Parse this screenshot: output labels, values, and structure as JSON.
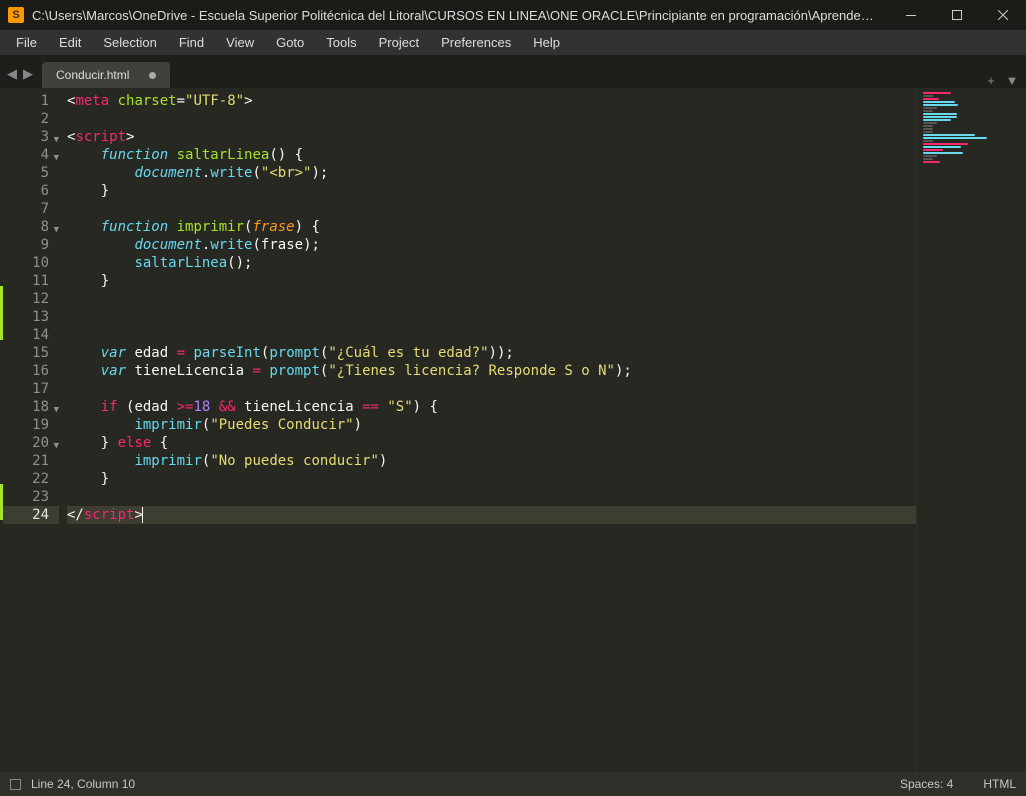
{
  "window": {
    "title": "C:\\Users\\Marcos\\OneDrive - Escuela Superior Politécnica del Litoral\\CURSOS EN LINEA\\ONE ORACLE\\Principiante en programación\\Aprender Logica de progra...",
    "logo_letter": "S"
  },
  "menu": {
    "items": [
      "File",
      "Edit",
      "Selection",
      "Find",
      "View",
      "Goto",
      "Tools",
      "Project",
      "Preferences",
      "Help"
    ]
  },
  "tabs": {
    "active": "Conducir.html",
    "active_dirty": true
  },
  "status": {
    "cursor": "Line 24, Column 10",
    "spacing": "Spaces: 4",
    "syntax": "HTML"
  },
  "code": {
    "lines": [
      {
        "n": 1,
        "fold": false,
        "tokens": [
          [
            "punc",
            "<"
          ],
          [
            "tag",
            "meta"
          ],
          [
            "punc",
            " "
          ],
          [
            "attr",
            "charset"
          ],
          [
            "punc",
            "="
          ],
          [
            "str",
            "\"UTF-8\""
          ],
          [
            "punc",
            ">"
          ]
        ]
      },
      {
        "n": 2,
        "fold": false,
        "tokens": []
      },
      {
        "n": 3,
        "fold": true,
        "tokens": [
          [
            "punc",
            "<"
          ],
          [
            "tag",
            "script"
          ],
          [
            "punc",
            ">"
          ]
        ]
      },
      {
        "n": 4,
        "fold": true,
        "tokens": [
          [
            "punc",
            "    "
          ],
          [
            "kw",
            "function"
          ],
          [
            "punc",
            " "
          ],
          [
            "fn",
            "saltarLinea"
          ],
          [
            "punc",
            "() {"
          ]
        ]
      },
      {
        "n": 5,
        "fold": false,
        "tokens": [
          [
            "punc",
            "        "
          ],
          [
            "obj",
            "document"
          ],
          [
            "punc",
            "."
          ],
          [
            "call",
            "write"
          ],
          [
            "punc",
            "("
          ],
          [
            "str",
            "\"<br>\""
          ],
          [
            "punc",
            ");"
          ]
        ]
      },
      {
        "n": 6,
        "fold": false,
        "tokens": [
          [
            "punc",
            "    }"
          ]
        ]
      },
      {
        "n": 7,
        "fold": false,
        "tokens": []
      },
      {
        "n": 8,
        "fold": true,
        "tokens": [
          [
            "punc",
            "    "
          ],
          [
            "kw",
            "function"
          ],
          [
            "punc",
            " "
          ],
          [
            "fn",
            "imprimir"
          ],
          [
            "punc",
            "("
          ],
          [
            "param",
            "frase"
          ],
          [
            "punc",
            ") {"
          ]
        ]
      },
      {
        "n": 9,
        "fold": false,
        "tokens": [
          [
            "punc",
            "        "
          ],
          [
            "obj",
            "document"
          ],
          [
            "punc",
            "."
          ],
          [
            "call",
            "write"
          ],
          [
            "punc",
            "("
          ],
          [
            "var",
            "frase"
          ],
          [
            "punc",
            ");"
          ]
        ]
      },
      {
        "n": 10,
        "fold": false,
        "tokens": [
          [
            "punc",
            "        "
          ],
          [
            "call",
            "saltarLinea"
          ],
          [
            "punc",
            "();"
          ]
        ]
      },
      {
        "n": 11,
        "fold": false,
        "tokens": [
          [
            "punc",
            "    }"
          ]
        ]
      },
      {
        "n": 12,
        "fold": false,
        "tokens": []
      },
      {
        "n": 13,
        "fold": false,
        "tokens": []
      },
      {
        "n": 14,
        "fold": false,
        "tokens": []
      },
      {
        "n": 15,
        "fold": false,
        "tokens": [
          [
            "punc",
            "    "
          ],
          [
            "kw",
            "var"
          ],
          [
            "punc",
            " "
          ],
          [
            "var",
            "edad"
          ],
          [
            "punc",
            " "
          ],
          [
            "kw2",
            "="
          ],
          [
            "punc",
            " "
          ],
          [
            "call",
            "parseInt"
          ],
          [
            "punc",
            "("
          ],
          [
            "call",
            "prompt"
          ],
          [
            "punc",
            "("
          ],
          [
            "str",
            "\"¿Cuál es tu edad?\""
          ],
          [
            "punc",
            "));"
          ]
        ]
      },
      {
        "n": 16,
        "fold": false,
        "tokens": [
          [
            "punc",
            "    "
          ],
          [
            "kw",
            "var"
          ],
          [
            "punc",
            " "
          ],
          [
            "var",
            "tieneLicencia"
          ],
          [
            "punc",
            " "
          ],
          [
            "kw2",
            "="
          ],
          [
            "punc",
            " "
          ],
          [
            "call",
            "prompt"
          ],
          [
            "punc",
            "("
          ],
          [
            "str",
            "\"¿Tienes licencia? Responde S o N\""
          ],
          [
            "punc",
            ");"
          ]
        ]
      },
      {
        "n": 17,
        "fold": false,
        "tokens": []
      },
      {
        "n": 18,
        "fold": true,
        "tokens": [
          [
            "punc",
            "    "
          ],
          [
            "kw2",
            "if"
          ],
          [
            "punc",
            " ("
          ],
          [
            "var",
            "edad"
          ],
          [
            "punc",
            " "
          ],
          [
            "kw2",
            ">="
          ],
          [
            "num",
            "18"
          ],
          [
            "punc",
            " "
          ],
          [
            "kw2",
            "&&"
          ],
          [
            "punc",
            " "
          ],
          [
            "var",
            "tieneLicencia"
          ],
          [
            "punc",
            " "
          ],
          [
            "kw2",
            "=="
          ],
          [
            "punc",
            " "
          ],
          [
            "str",
            "\"S\""
          ],
          [
            "punc",
            ") {"
          ]
        ]
      },
      {
        "n": 19,
        "fold": false,
        "tokens": [
          [
            "punc",
            "        "
          ],
          [
            "call",
            "imprimir"
          ],
          [
            "punc",
            "("
          ],
          [
            "str",
            "\"Puedes Conducir\""
          ],
          [
            "punc",
            ")"
          ]
        ]
      },
      {
        "n": 20,
        "fold": true,
        "tokens": [
          [
            "punc",
            "    } "
          ],
          [
            "kw2",
            "else"
          ],
          [
            "punc",
            " {"
          ]
        ]
      },
      {
        "n": 21,
        "fold": false,
        "tokens": [
          [
            "punc",
            "        "
          ],
          [
            "call",
            "imprimir"
          ],
          [
            "punc",
            "("
          ],
          [
            "str",
            "\"No puedes conducir\""
          ],
          [
            "punc",
            ")"
          ]
        ]
      },
      {
        "n": 22,
        "fold": false,
        "tokens": [
          [
            "punc",
            "    }"
          ]
        ]
      },
      {
        "n": 23,
        "fold": false,
        "tokens": []
      },
      {
        "n": 24,
        "fold": false,
        "active": true,
        "tokens": [
          [
            "punc",
            "</"
          ],
          [
            "tag",
            "script"
          ],
          [
            "punc",
            ">"
          ]
        ],
        "cursor": true
      }
    ],
    "modified_ranges": [
      [
        12,
        14
      ],
      [
        23,
        24
      ]
    ]
  },
  "minimap": {
    "colors": [
      "#f92672",
      "#a6e22e",
      "#e6db74",
      "#66d9ef",
      "#f8f8f2",
      "#fd971f"
    ]
  }
}
